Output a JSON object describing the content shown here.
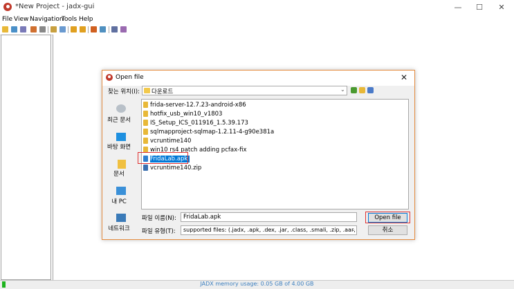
{
  "window": {
    "title": "*New Project - jadx-gui",
    "minimize": "—",
    "maximize": "☐",
    "close": "✕"
  },
  "menu": [
    "File",
    "View",
    "Navigation",
    "Tools",
    "Help"
  ],
  "status": {
    "memory": "JADX memory usage: 0.05 GB of 4.00 GB",
    "memory_fraction": 0.0125
  },
  "dialog": {
    "title": "Open file",
    "close": "✕",
    "look_in_label": "찾는 위치(I):",
    "look_in_value": "다운로드",
    "places": [
      "최근 문서",
      "바탕 화면",
      "문서",
      "내 PC",
      "네트워크"
    ],
    "files": [
      {
        "name": "frida-server-12.7.23-android-x86",
        "kind": "folder"
      },
      {
        "name": "hotfix_usb_win10_v1803",
        "kind": "folder"
      },
      {
        "name": "IS_Setup_ICS_011916_1.5.39.173",
        "kind": "folder"
      },
      {
        "name": "sqlmapproject-sqlmap-1.2.11-4-g90e381a",
        "kind": "folder"
      },
      {
        "name": "vcruntime140",
        "kind": "folder"
      },
      {
        "name": "win10 rs4 patch adding pcfax-fix",
        "kind": "folder"
      },
      {
        "name": "FridaLab.apk",
        "kind": "apk",
        "selected": true
      },
      {
        "name": "vcruntime140.zip",
        "kind": "zip"
      }
    ],
    "file_name_label": "파일 이름(N):",
    "file_name_value": "FridaLab.apk",
    "file_type_label": "파일 유형(T):",
    "file_type_value": "supported files: (.jadx, .apk, .dex, .jar, .class, .smali, .zip, .aar, .arsc)",
    "open_button": "Open file",
    "cancel_button": "취소"
  },
  "colors": {
    "accent": "#0078d7",
    "highlight": "#e03030",
    "memory": "#1db31d"
  }
}
